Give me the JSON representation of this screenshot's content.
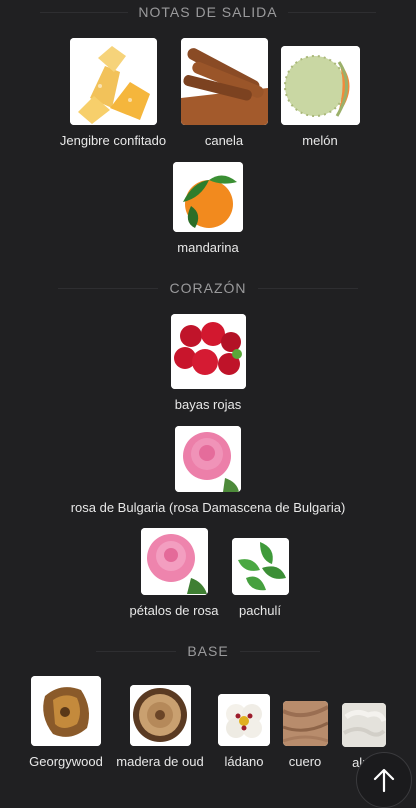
{
  "sections": {
    "top": {
      "title": "NOTAS DE SALIDA"
    },
    "heart": {
      "title": "CORAZÓN"
    },
    "base": {
      "title": "BASE"
    }
  },
  "notes": {
    "jengibre": "Jengibre confitado",
    "canela": "canela",
    "melon": "melón",
    "mandarina": "mandarina",
    "bayas": "bayas rojas",
    "rosa_bulgaria": "rosa de Bulgaria (rosa Damascena de Bulgaria)",
    "petalos": "pétalos de rosa",
    "pachuli": "pachulí",
    "georgywood": "Georgywood",
    "oud": "madera de oud",
    "ladano": "ládano",
    "cuero": "cuero",
    "almizcle": "almi"
  },
  "icons": {
    "scroll_top": "arrow-up-icon"
  }
}
